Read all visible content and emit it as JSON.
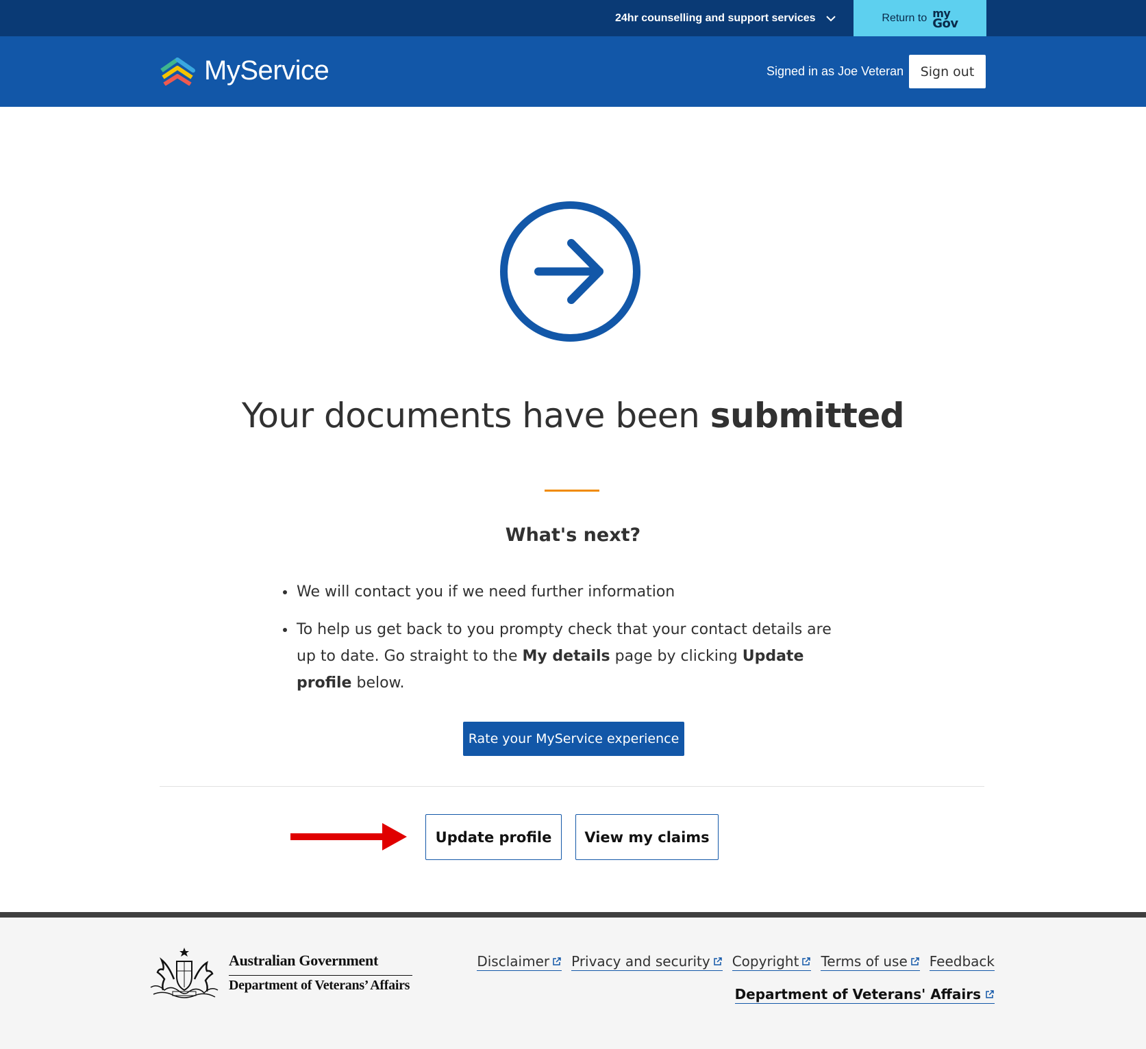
{
  "utility_bar": {
    "support_label": "24hr counselling and support services",
    "return_label": "Return to",
    "mygov_my": "my",
    "mygov_gov": "Gov"
  },
  "header": {
    "brand_name": "MyService",
    "signed_in_text": "Signed in as Joe Veteran",
    "sign_out_label": "Sign out"
  },
  "main": {
    "title_regular": "Your documents have been ",
    "title_bold": "submitted",
    "next_heading": "What's next?",
    "bullets": {
      "first": "We will contact you if we need further information",
      "second_part1": "To help us get back to you prompty check that your contact details are up to date. Go straight to the ",
      "second_bold1": "My details",
      "second_part2": " page by clicking ",
      "second_bold2": "Update profile",
      "second_part3": " below."
    },
    "rate_button_label": "Rate your MyService experience",
    "update_profile_label": "Update profile",
    "view_claims_label": "View my claims"
  },
  "footer": {
    "gov_name": "Australian Government",
    "dept_name": "Department of  Veterans’ Affairs",
    "links": {
      "disclaimer": "Disclaimer",
      "privacy": "Privacy and security",
      "copyright": "Copyright",
      "terms": "Terms of use",
      "feedback": "Feedback"
    },
    "dept_link": "Department of Veterans' Affairs"
  },
  "colors": {
    "utility_bar": "#0a3a75",
    "header": "#1257a8",
    "mygov_button": "#5dd0ef",
    "accent_rule": "#f08a00",
    "annotation_arrow": "#e00000"
  },
  "icons": {
    "support_toggle": "chevron-down-icon",
    "status": "arrow-right-circle-icon",
    "external": "external-link-icon",
    "annotation": "red-arrow-icon"
  }
}
